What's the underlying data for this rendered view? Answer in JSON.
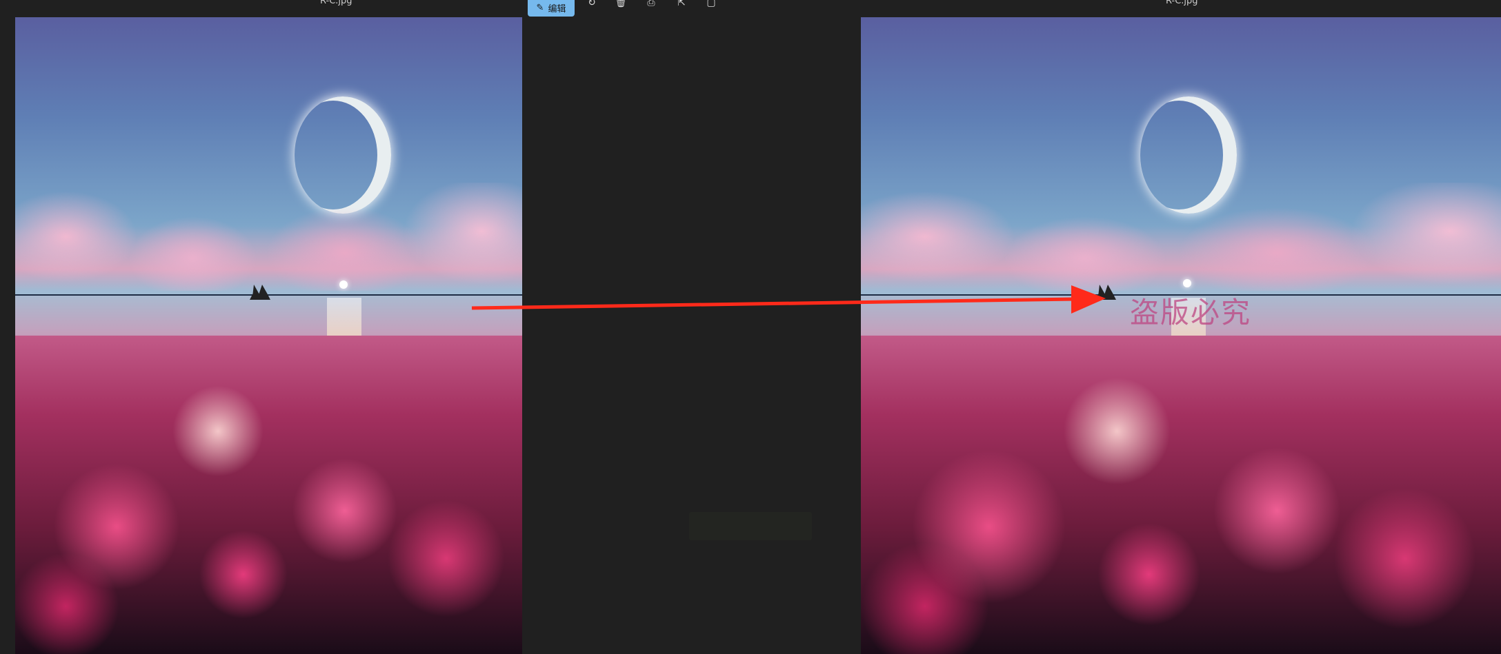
{
  "left_viewer": {
    "title": "R-C.jpg"
  },
  "right_viewer": {
    "title": "R-C.jpg",
    "watermark": "盗版必究"
  },
  "toolbar": {
    "edit_label": "编辑",
    "icons": [
      "edit-pencil-icon",
      "rotate-icon",
      "delete-icon",
      "print-icon",
      "share-icon",
      "edit-image-icon",
      "more-icon"
    ],
    "more_glyph": "···"
  },
  "annotation": {
    "arrow_color": "#ff2a1a"
  },
  "colors": {
    "background": "#202020",
    "accent": "#76b9ed"
  }
}
